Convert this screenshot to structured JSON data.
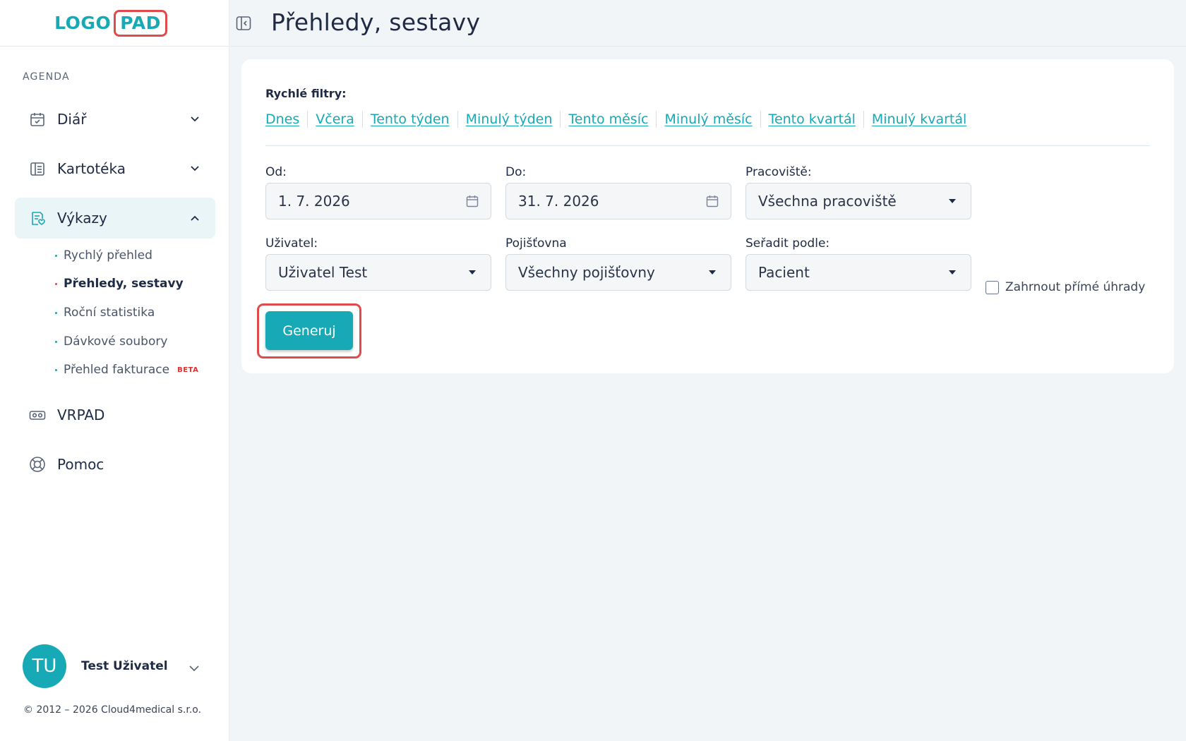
{
  "brand": {
    "logo_left": "LOGO",
    "logo_right": "PAD",
    "accent": "#17a9b5",
    "highlight": "#e04a4a"
  },
  "sidebar": {
    "section_label": "AGENDA",
    "items": [
      {
        "label": "Diář",
        "icon": "calendar-icon",
        "expandable": true,
        "expanded": false
      },
      {
        "label": "Kartotéka",
        "icon": "card-index-icon",
        "expandable": true,
        "expanded": false
      },
      {
        "label": "Výkazy",
        "icon": "report-icon",
        "expandable": true,
        "expanded": true
      },
      {
        "label": "VRPAD",
        "icon": "vr-headset-icon",
        "expandable": false
      },
      {
        "label": "Pomoc",
        "icon": "lifebuoy-icon",
        "expandable": false
      }
    ],
    "subitems": [
      {
        "label": "Rychlý přehled"
      },
      {
        "label": "Přehledy, sestavy",
        "current": true
      },
      {
        "label": "Roční statistika"
      },
      {
        "label": "Dávkové soubory"
      },
      {
        "label": "Přehled fakturace",
        "badge": "BETA"
      }
    ],
    "user": {
      "initials": "TU",
      "name": "Test Uživatel"
    },
    "copyright": "© 2012 – 2026 Cloud4medical s.r.o."
  },
  "header": {
    "title": "Přehledy, sestavy"
  },
  "filters": {
    "quick_label": "Rychlé filtry:",
    "quick_links": [
      "Dnes",
      "Včera",
      "Tento týden",
      "Minulý týden",
      "Tento měsíc",
      "Minulý měsíc",
      "Tento kvartál",
      "Minulý kvartál"
    ],
    "from_label": "Od:",
    "from_value": "1. 7. 2026",
    "to_label": "Do:",
    "to_value": "31. 7. 2026",
    "workplace_label": "Pracoviště:",
    "workplace_value": "Všechna pracoviště",
    "user_label": "Uživatel:",
    "user_value": "Uživatel Test",
    "insurer_label": "Pojišťovna",
    "insurer_value": "Všechny pojišťovny",
    "sort_label": "Seřadit podle:",
    "sort_value": "Pacient",
    "direct_payments_label": "Zahrnout přímé úhrady",
    "direct_payments_checked": false,
    "generate_label": "Generuj"
  }
}
